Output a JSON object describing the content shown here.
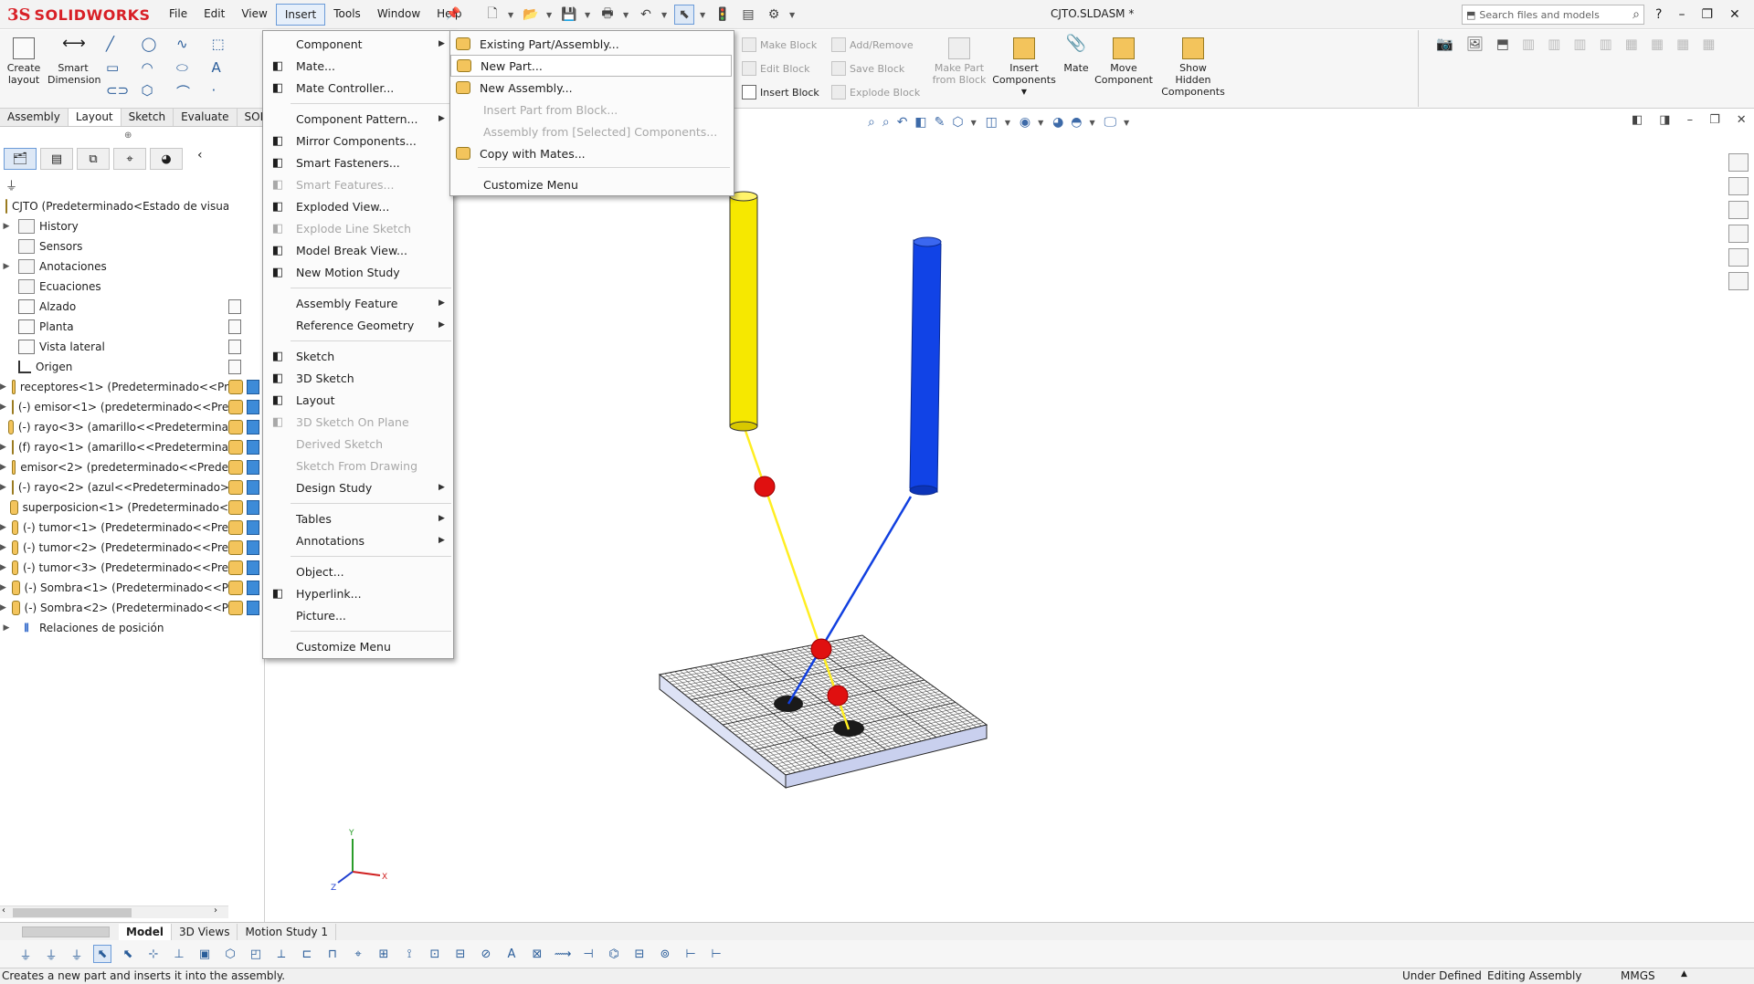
{
  "app": {
    "brand": "SOLIDWORKS",
    "doc_title": "CJTO.SLDASM *"
  },
  "menubar": [
    "File",
    "Edit",
    "View",
    "Insert",
    "Tools",
    "Window",
    "Help"
  ],
  "search": {
    "placeholder": "Search files and models"
  },
  "command_manager": {
    "create_layout": "Create\nlayout",
    "smart_dimension": "Smart\nDimension",
    "block_items": [
      {
        "label": "Make Block",
        "enabled": false
      },
      {
        "label": "Edit Block",
        "enabled": false
      },
      {
        "label": "Insert Block",
        "enabled": true
      },
      {
        "label": "Add/Remove",
        "enabled": false
      },
      {
        "label": "Save Block",
        "enabled": false
      },
      {
        "label": "Explode Block",
        "enabled": false
      }
    ],
    "make_part_from_block": "Make Part\nfrom Block",
    "insert_components": "Insert\nComponents",
    "mate": "Mate",
    "move_component": "Move\nComponent",
    "show_hidden_components": "Show\nHidden\nComponents"
  },
  "cm_tabs": [
    "Assembly",
    "Layout",
    "Sketch",
    "Evaluate",
    "SOLIDW"
  ],
  "cm_active_tab": "Layout",
  "tree": {
    "root": "CJTO  (Predeterminado<Estado de visualiz",
    "items": [
      {
        "label": "History",
        "icon": "folder-icon",
        "expand": true
      },
      {
        "label": "Sensors",
        "icon": "folder-icon",
        "expand": false
      },
      {
        "label": "Anotaciones",
        "icon": "folder-icon",
        "expand": true
      },
      {
        "label": "Ecuaciones",
        "icon": "folder-icon",
        "expand": false
      },
      {
        "label": "Alzado",
        "icon": "plane-icon",
        "expand": false
      },
      {
        "label": "Planta",
        "icon": "plane-icon",
        "expand": false
      },
      {
        "label": "Vista lateral",
        "icon": "plane-icon",
        "expand": false
      },
      {
        "label": "Origen",
        "icon": "origin-icon",
        "expand": false
      },
      {
        "label": "receptores<1> (Predeterminado<<Pr",
        "icon": "component-icon",
        "expand": true
      },
      {
        "label": "(-) emisor<1> (predeterminado<<Pre",
        "icon": "component-icon",
        "expand": true
      },
      {
        "label": "(-) rayo<3> (amarillo<<Predetermina",
        "icon": "component-icon",
        "expand": false
      },
      {
        "label": "(f) rayo<1> (amarillo<<Predetermina",
        "icon": "component-icon",
        "expand": true
      },
      {
        "label": "emisor<2> (predeterminado<<Prede",
        "icon": "component-icon",
        "expand": true
      },
      {
        "label": "(-) rayo<2> (azul<<Predeterminado>",
        "icon": "component-icon",
        "expand": true
      },
      {
        "label": "superposicion<1> (Predeterminado<",
        "icon": "component-icon",
        "expand": false
      },
      {
        "label": "(-) tumor<1> (Predeterminado<<Pre",
        "icon": "component-icon",
        "expand": true
      },
      {
        "label": "(-) tumor<2> (Predeterminado<<Pre",
        "icon": "component-icon",
        "expand": true
      },
      {
        "label": "(-) tumor<3> (Predeterminado<<Pre",
        "icon": "component-icon",
        "expand": true
      },
      {
        "label": "(-) Sombra<1> (Predeterminado<<P",
        "icon": "component-icon",
        "expand": true
      },
      {
        "label": "(-) Sombra<2> (Predeterminado<<P",
        "icon": "component-icon",
        "expand": true
      },
      {
        "label": "Relaciones de posición",
        "icon": "mate-icon",
        "expand": true
      }
    ]
  },
  "insert_menu": [
    {
      "label": "Component",
      "enabled": true,
      "submenu": true,
      "icon": ""
    },
    {
      "label": "Mate...",
      "enabled": true,
      "submenu": false,
      "icon": "paperclip-icon"
    },
    {
      "label": "Mate Controller...",
      "enabled": true,
      "submenu": false,
      "icon": "mate-controller-icon"
    },
    {
      "label": "Component Pattern...",
      "enabled": true,
      "submenu": true,
      "icon": ""
    },
    {
      "label": "Mirror Components...",
      "enabled": true,
      "submenu": false,
      "icon": "mirror-icon"
    },
    {
      "label": "Smart Fasteners...",
      "enabled": true,
      "submenu": false,
      "icon": "fastener-icon"
    },
    {
      "label": "Smart Features...",
      "enabled": false,
      "submenu": false,
      "icon": "smart-feature-icon"
    },
    {
      "label": "Exploded View...",
      "enabled": true,
      "submenu": false,
      "icon": "exploded-view-icon"
    },
    {
      "label": "Explode Line Sketch",
      "enabled": false,
      "submenu": false,
      "icon": "explode-line-icon"
    },
    {
      "label": "Model Break View...",
      "enabled": true,
      "submenu": false,
      "icon": "break-view-icon"
    },
    {
      "label": "New Motion Study",
      "enabled": true,
      "submenu": false,
      "icon": "motion-study-icon"
    },
    {
      "label": "Assembly Feature",
      "enabled": true,
      "submenu": true,
      "icon": ""
    },
    {
      "label": "Reference Geometry",
      "enabled": true,
      "submenu": true,
      "icon": ""
    },
    {
      "label": "Sketch",
      "enabled": true,
      "submenu": false,
      "icon": "sketch-icon"
    },
    {
      "label": "3D Sketch",
      "enabled": true,
      "submenu": false,
      "icon": "3d-sketch-icon"
    },
    {
      "label": "Layout",
      "enabled": true,
      "submenu": false,
      "icon": "layout-icon"
    },
    {
      "label": "3D Sketch On Plane",
      "enabled": false,
      "submenu": false,
      "icon": "3d-sketch-plane-icon"
    },
    {
      "label": "Derived Sketch",
      "enabled": false,
      "submenu": false,
      "icon": ""
    },
    {
      "label": "Sketch From Drawing",
      "enabled": false,
      "submenu": false,
      "icon": ""
    },
    {
      "label": "Design Study",
      "enabled": true,
      "submenu": true,
      "icon": ""
    },
    {
      "label": "Tables",
      "enabled": true,
      "submenu": true,
      "icon": ""
    },
    {
      "label": "Annotations",
      "enabled": true,
      "submenu": true,
      "icon": ""
    },
    {
      "label": "Object...",
      "enabled": true,
      "submenu": false,
      "icon": ""
    },
    {
      "label": "Hyperlink...",
      "enabled": true,
      "submenu": false,
      "icon": "hyperlink-icon"
    },
    {
      "label": "Picture...",
      "enabled": true,
      "submenu": false,
      "icon": ""
    },
    {
      "label": "Customize Menu",
      "enabled": true,
      "submenu": false,
      "icon": ""
    }
  ],
  "component_submenu": [
    {
      "label": "Existing Part/Assembly...",
      "enabled": true,
      "icon": "existing-part-icon"
    },
    {
      "label": "New Part...",
      "enabled": true,
      "icon": "new-part-icon",
      "highlighted": true
    },
    {
      "label": "New Assembly...",
      "enabled": true,
      "icon": "new-assembly-icon"
    },
    {
      "label": "Insert Part from Block...",
      "enabled": false,
      "icon": ""
    },
    {
      "label": "Assembly from [Selected] Components...",
      "enabled": false,
      "icon": ""
    },
    {
      "label": "Copy with Mates...",
      "enabled": true,
      "icon": "copy-mates-icon"
    },
    {
      "label": "Customize Menu",
      "enabled": true,
      "icon": ""
    }
  ],
  "bottom_tabs": [
    "Model",
    "3D Views",
    "Motion Study 1"
  ],
  "bottom_active_tab": "Model",
  "status": {
    "message": "Creates a new part and inserts it into the assembly.",
    "state": "Under Defined",
    "mode": "Editing Assembly",
    "units": "MMGS"
  },
  "colors": {
    "brand_red": "#d81f26",
    "ray_yellow": "#ffee22",
    "ray_blue": "#1140e0",
    "tumor_red": "#e01010"
  }
}
